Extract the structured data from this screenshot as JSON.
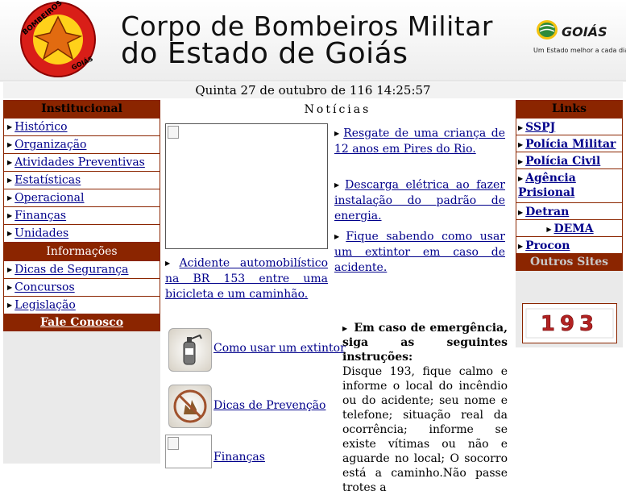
{
  "header": {
    "logo_top_text": "BOMBEIROS",
    "logo_bottom_text": "GOIÁS",
    "title_line1": "Corpo de Bombeiros Militar",
    "title_line2": "do Estado de Goiás",
    "goias_name": "GOIÁS",
    "goias_slogan": "Um Estado melhor a cada dia"
  },
  "date_text": "Quinta 27 de outubro de 116 14:25:57",
  "left_nav": {
    "institucional_title": "Institucional",
    "institucional_items": [
      "Histórico",
      "Organização",
      "Atividades Preventivas",
      "Estatísticas",
      "Operacional",
      "Finanças",
      "Unidades"
    ],
    "informacoes_title": "Informações",
    "informacoes_items": [
      "Dicas de Segurança",
      "Concursos",
      "Legislação"
    ],
    "fale_conosco": "Fale Conosco"
  },
  "news": {
    "title": "Notícias",
    "item1": "Acidente automobilístico na BR 153 entre uma bicicleta e um caminhão.",
    "item2": "Resgate de uma criança de 12 anos em Pires do Rio.",
    "item3": "Descarga elétrica ao fazer instalação do padrão de energia.",
    "item4": "Fique sabendo como usar um extintor em caso de acidente."
  },
  "quick_links": {
    "extintor": "Como usar um extintor",
    "prevencao": "Dicas de Prevenção",
    "financas": "Finanças"
  },
  "emergency": {
    "heading": "Em caso de emergência, siga as seguintes instruções:",
    "body": "Disque 193, fique calmo e informe o local do incêndio ou do acidente; seu nome e telefone; situação real da ocorrência; informe se existe vítimas ou não e aguarde no local; O socorro está a caminho.Não passe trotes a"
  },
  "right_nav": {
    "links_title": "Links",
    "items": [
      "SSPJ",
      "Polícia Militar",
      "Polícia Civil",
      "Agência Prisional",
      "Detran",
      "DEMA",
      "Procon"
    ],
    "outros_sites": "Outros Sites",
    "banner_number": "193"
  }
}
